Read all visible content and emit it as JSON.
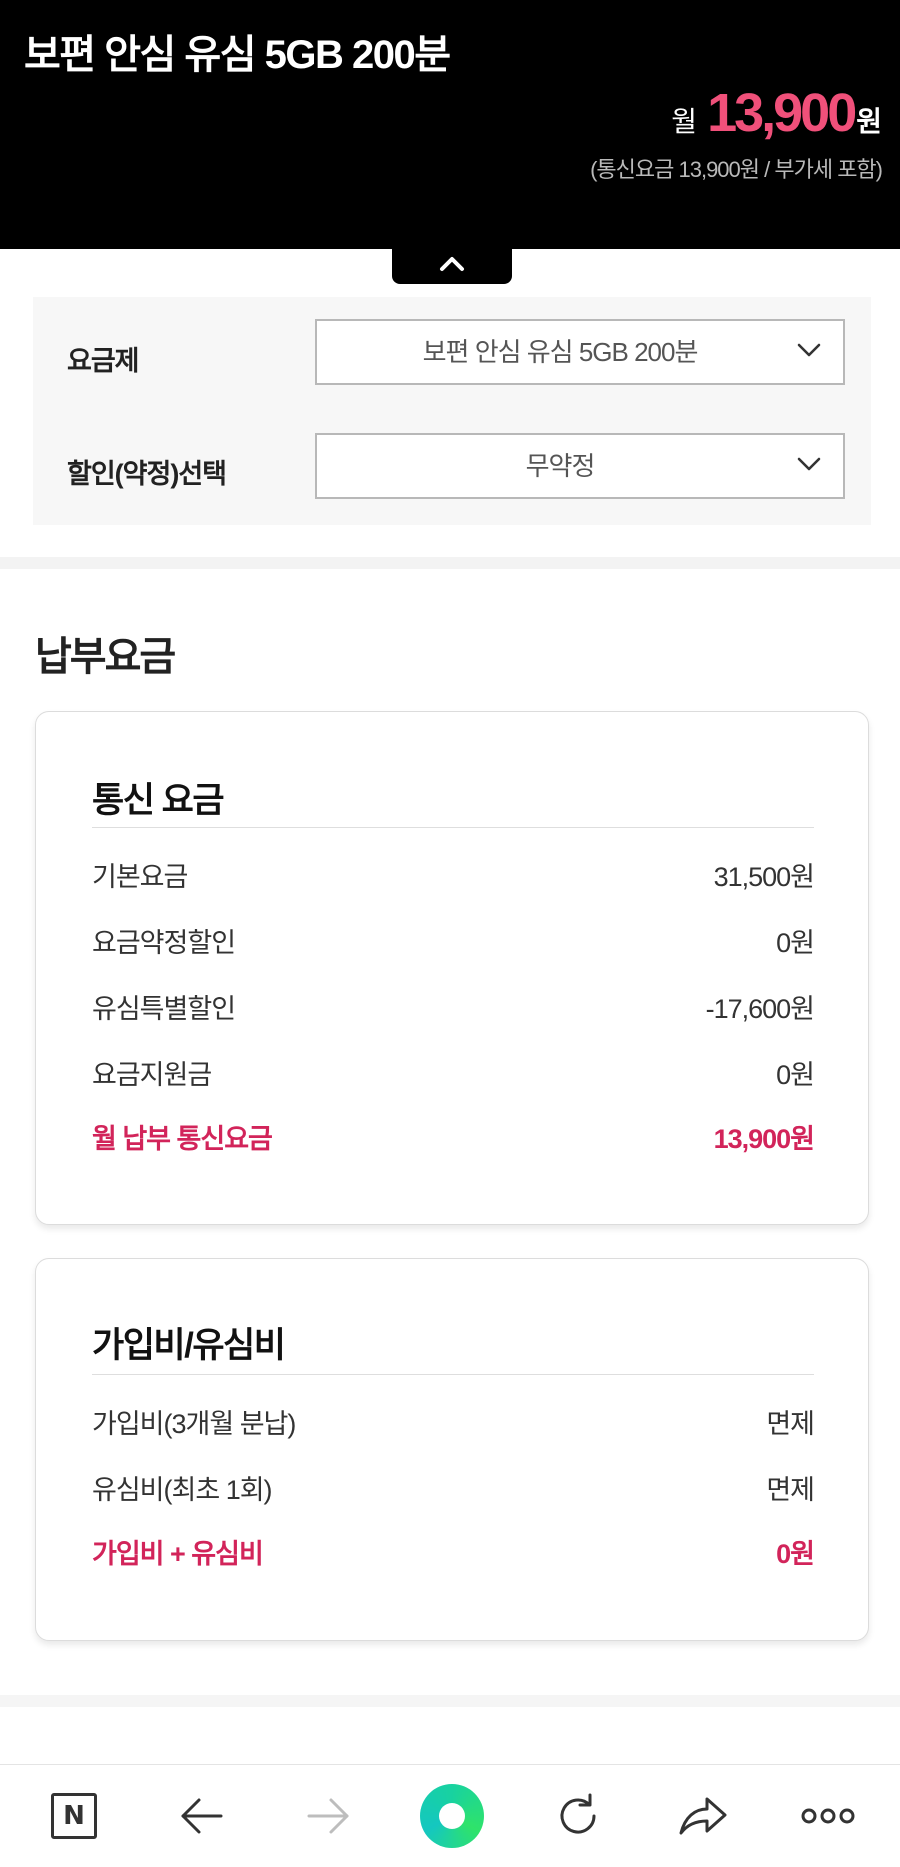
{
  "header": {
    "plan_name": "보편 안심 유심 5GB 200분",
    "price_prefix": "월",
    "price_amount": "13,900",
    "price_unit": "원",
    "price_note": "(통신요금 13,900원 / 부가세 포함)"
  },
  "colors": {
    "header_bg": "#000000",
    "accent_price": "#f0507a",
    "accent_total": "#d2245a",
    "panel_bg": "#f7f7f7"
  },
  "selectors": {
    "plan_label": "요금제",
    "plan_value": "보편 안심 유심 5GB 200분",
    "discount_label": "할인(약정)선택",
    "discount_value": "무약정"
  },
  "payment": {
    "section_title": "납부요금",
    "telecom": {
      "title": "통신 요금",
      "rows": [
        {
          "label": "기본요금",
          "value": "31,500원"
        },
        {
          "label": "요금약정할인",
          "value": "0원"
        },
        {
          "label": "유심특별할인",
          "value": "-17,600원"
        },
        {
          "label": "요금지원금",
          "value": "0원"
        }
      ],
      "total_label": "월 납부 통신요금",
      "total_value": "13,900원"
    },
    "signup": {
      "title": "가입비/유심비",
      "rows": [
        {
          "label": "가입비(3개월 분납)",
          "value": "면제"
        },
        {
          "label": "유심비(최초 1회)",
          "value": "면제"
        }
      ],
      "total_label": "가입비 + 유심비",
      "total_value": "0원"
    }
  },
  "browser_bar": {
    "home_letter": "N",
    "icons": [
      "naver-home-icon",
      "back-arrow-icon",
      "forward-arrow-icon",
      "green-dot-icon",
      "reload-icon",
      "share-icon",
      "more-icon"
    ]
  }
}
